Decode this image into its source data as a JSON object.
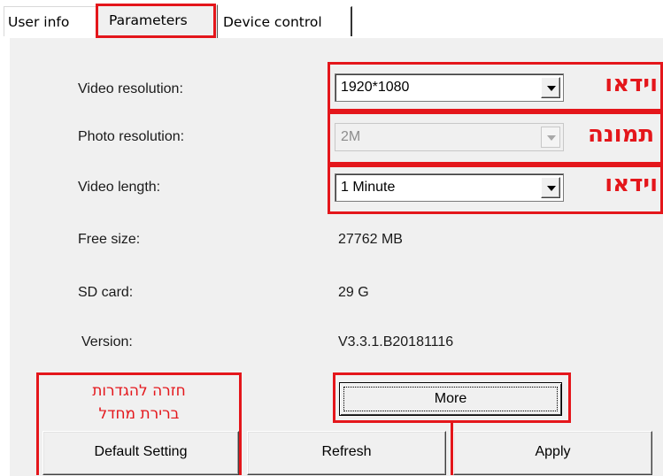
{
  "tabs": [
    {
      "label": "User info"
    },
    {
      "label": "Parameters"
    },
    {
      "label": "Device control"
    }
  ],
  "parameters": {
    "video_resolution": {
      "label": "Video resolution:",
      "value": "1920*1080",
      "annotation": "וידאו"
    },
    "photo_resolution": {
      "label": "Photo resolution:",
      "value": "2M",
      "annotation": "תמונה",
      "disabled": true
    },
    "video_length": {
      "label": "Video length:",
      "value": "1 Minute",
      "annotation": "וידאו"
    },
    "free_size": {
      "label": "Free size:",
      "value": "27762 MB"
    },
    "sd_card": {
      "label": "SD card:",
      "value": "29 G"
    },
    "version": {
      "label": "Version:",
      "value": "V3.3.1.B20181116"
    }
  },
  "buttons": {
    "more": "More",
    "default_setting": "Default Setting",
    "refresh": "Refresh",
    "apply": "Apply"
  },
  "annotations": {
    "default_note_line1": "חזרה להגדרות",
    "default_note_line2": "ברירת מחדל",
    "color": "#e4161b"
  }
}
